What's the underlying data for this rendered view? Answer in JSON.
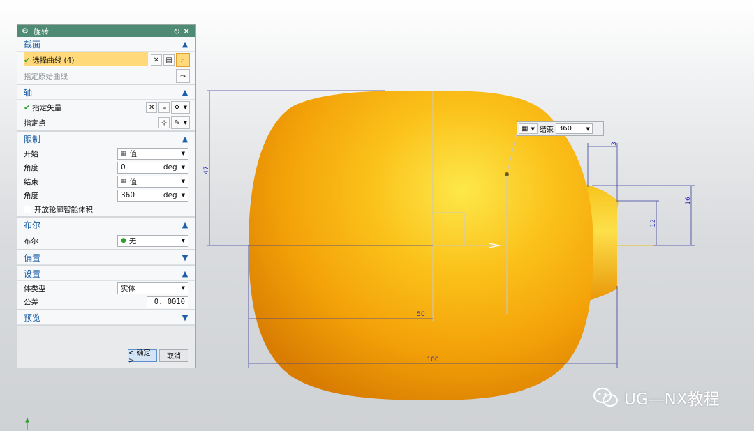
{
  "dialog": {
    "title": "旋转",
    "sections": {
      "section": {
        "title": "截面",
        "select_curve": "选择曲线 (4)",
        "specify_original_curve": "指定原始曲线"
      },
      "axis": {
        "title": "轴",
        "specify_vector": "指定矢量",
        "specify_point": "指定点"
      },
      "limits": {
        "title": "限制",
        "start_label": "开始",
        "start_value": "值",
        "start_angle_label": "角度",
        "start_angle_value": "0",
        "end_label": "结束",
        "end_value": "值",
        "end_angle_label": "角度",
        "end_angle_value": "360",
        "unit": "deg",
        "open_profile_label": "开放轮廓智能体积"
      },
      "boolean": {
        "title": "布尔",
        "label": "布尔",
        "value": "无"
      },
      "offset": {
        "title": "偏置"
      },
      "settings": {
        "title": "设置",
        "body_type_label": "体类型",
        "body_type_value": "实体",
        "tolerance_label": "公差",
        "tolerance_value": "0. 0010"
      },
      "preview": {
        "title": "预览"
      }
    },
    "buttons": {
      "ok": "< 确定 >",
      "cancel": "取消"
    }
  },
  "float_toolbar": {
    "label": "结束",
    "value": "360"
  },
  "dimensions": {
    "d1": "47",
    "d2": "3",
    "d3": "16",
    "d4": "12",
    "d5": "50",
    "d6": "100"
  },
  "watermark": "UG—NX教程",
  "colors": {
    "title_bar": "#4f8a75",
    "section_header_text": "#1c5fa6",
    "highlight": "#ffd97a",
    "body_orange": "#f5a00a",
    "dimension_blue": "#2b2bb8"
  }
}
